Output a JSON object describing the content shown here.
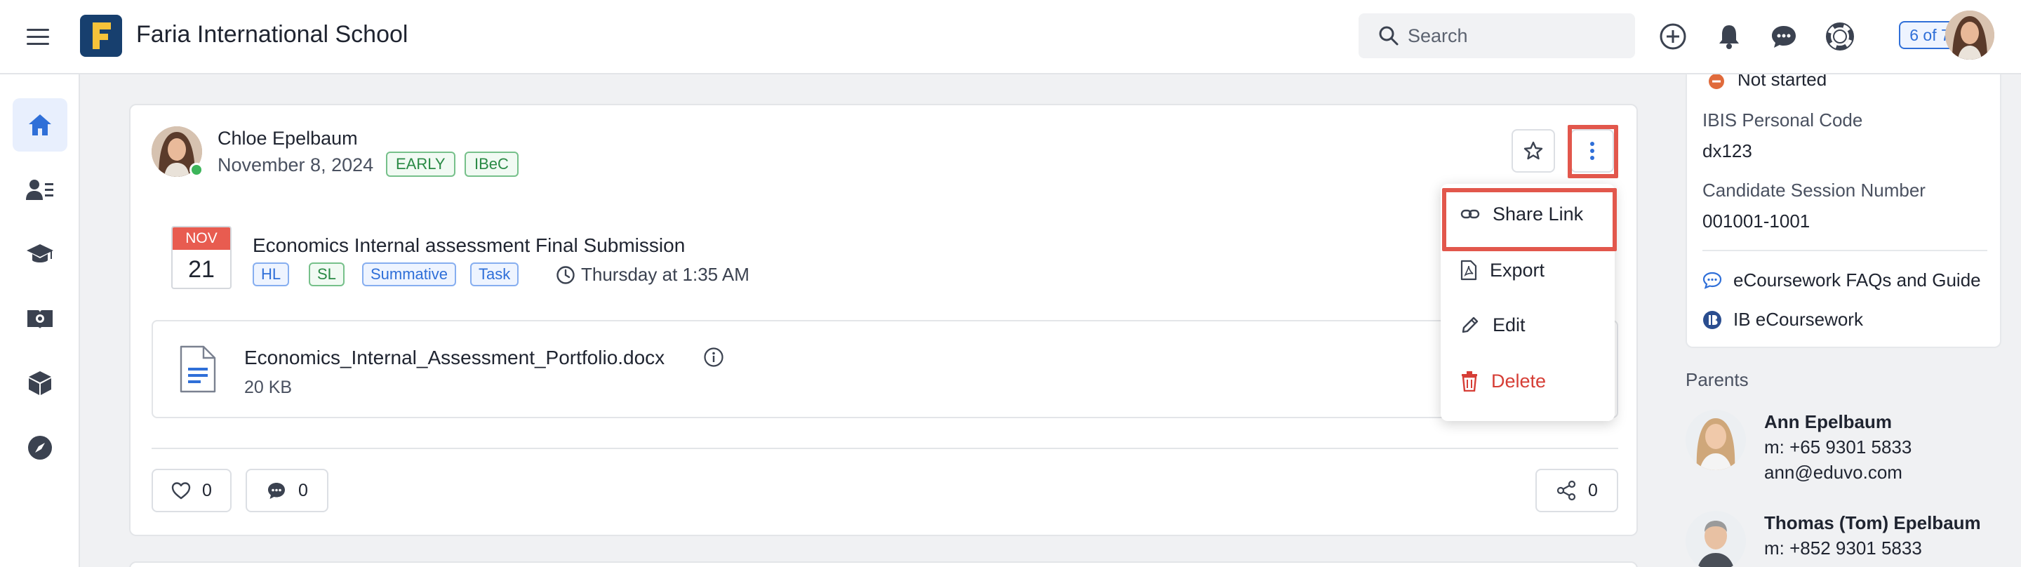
{
  "header": {
    "school_name": "Faria International School",
    "search_placeholder": "Search",
    "pager": "6 of 7"
  },
  "post": {
    "author": "Chloe Epelbaum",
    "date": "November 8, 2024",
    "tags": [
      "EARLY",
      "IBeC"
    ],
    "task": {
      "month": "NOV",
      "day": "21",
      "title": "Economics Internal assessment Final Submission",
      "tags": [
        "HL",
        "SL",
        "Summative",
        "Task"
      ],
      "time": "Thursday at 1:35 AM"
    },
    "file": {
      "name": "Economics_Internal_Assessment_Portfolio.docx",
      "size": "20 KB"
    },
    "likes": "0",
    "comments": "0",
    "shares": "0"
  },
  "menu": {
    "share": "Share Link",
    "export": "Export",
    "edit": "Edit",
    "delete": "Delete"
  },
  "right_panel": {
    "status": "Not started",
    "ibis_label": "IBIS Personal Code",
    "ibis_value": "dx123",
    "session_label": "Candidate Session Number",
    "session_value": "001001-1001",
    "link1": "eCoursework FAQs and Guide",
    "link2": "IB eCoursework",
    "parents_heading": "Parents",
    "parents": [
      {
        "name": "Ann Epelbaum",
        "phone": "m: +65 9301 5833",
        "email": "ann@eduvo.com"
      },
      {
        "name": "Thomas (Tom) Epelbaum",
        "phone": "m: +852 9301 5833"
      }
    ]
  },
  "colors": {
    "accent": "#2f6fd8",
    "highlight": "#e2574c",
    "danger": "#d63e36",
    "success": "#3cb55a"
  }
}
